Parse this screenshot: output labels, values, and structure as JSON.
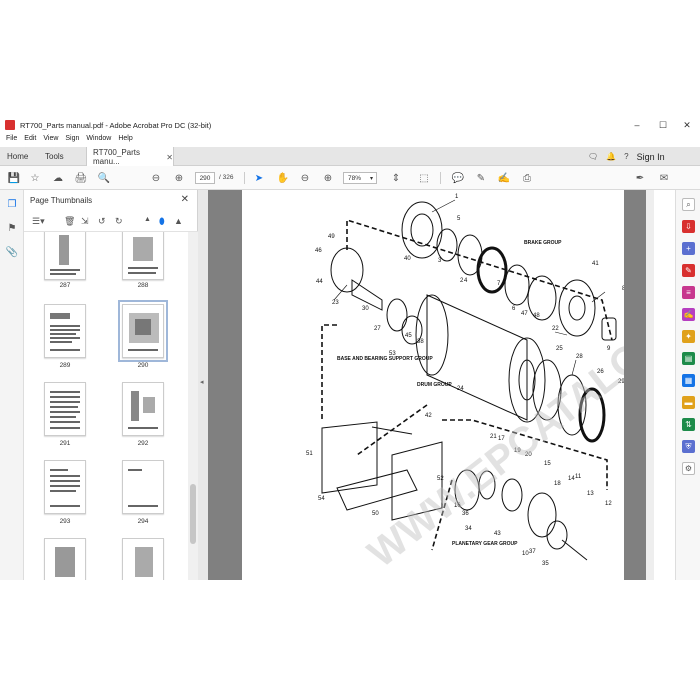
{
  "window": {
    "title": "RT700_Parts manual.pdf - Adobe Acrobat Pro DC (32-bit)",
    "minimize": "–",
    "maximize": "☐",
    "close": "✕"
  },
  "menu": [
    "File",
    "Edit",
    "View",
    "Sign",
    "Window",
    "Help"
  ],
  "tabs": {
    "home": "Home",
    "tools": "Tools",
    "document": "RT700_Parts manu...",
    "close": "✕"
  },
  "header_right": {
    "sign_in": "Sign In"
  },
  "toolbar": {
    "current_page": "290",
    "total_pages": "/ 326",
    "zoom": "78%"
  },
  "thumbnails": {
    "title": "Page Thumbnails",
    "close": "✕",
    "pages": [
      "287",
      "288",
      "289",
      "290",
      "291",
      "292",
      "293",
      "294"
    ]
  },
  "drawing": {
    "labels": [
      "1",
      "2",
      "3",
      "4",
      "5",
      "6",
      "7",
      "8",
      "9",
      "10",
      "11",
      "12",
      "13",
      "14",
      "15",
      "16",
      "17",
      "18",
      "19",
      "20",
      "21",
      "22",
      "23",
      "24",
      "25",
      "26",
      "27",
      "28",
      "29",
      "30",
      "34",
      "35",
      "36",
      "37",
      "38",
      "40",
      "41",
      "42",
      "43",
      "44",
      "45",
      "46",
      "47",
      "48",
      "49",
      "50",
      "51",
      "52",
      "53",
      "54"
    ],
    "groups": {
      "brake": "BRAKE GROUP",
      "base": "BASE AND BEARING SUPPORT GROUP",
      "drum": "DRUM GROUP",
      "planetary": "PLANETARY GEAR GROUP"
    },
    "watermark": "WWW.EPCATALOGS.COM"
  },
  "colors": {
    "accent_blue": "#1473e6",
    "acrobat_red": "#d8302f",
    "doc_gray": "#808080"
  }
}
